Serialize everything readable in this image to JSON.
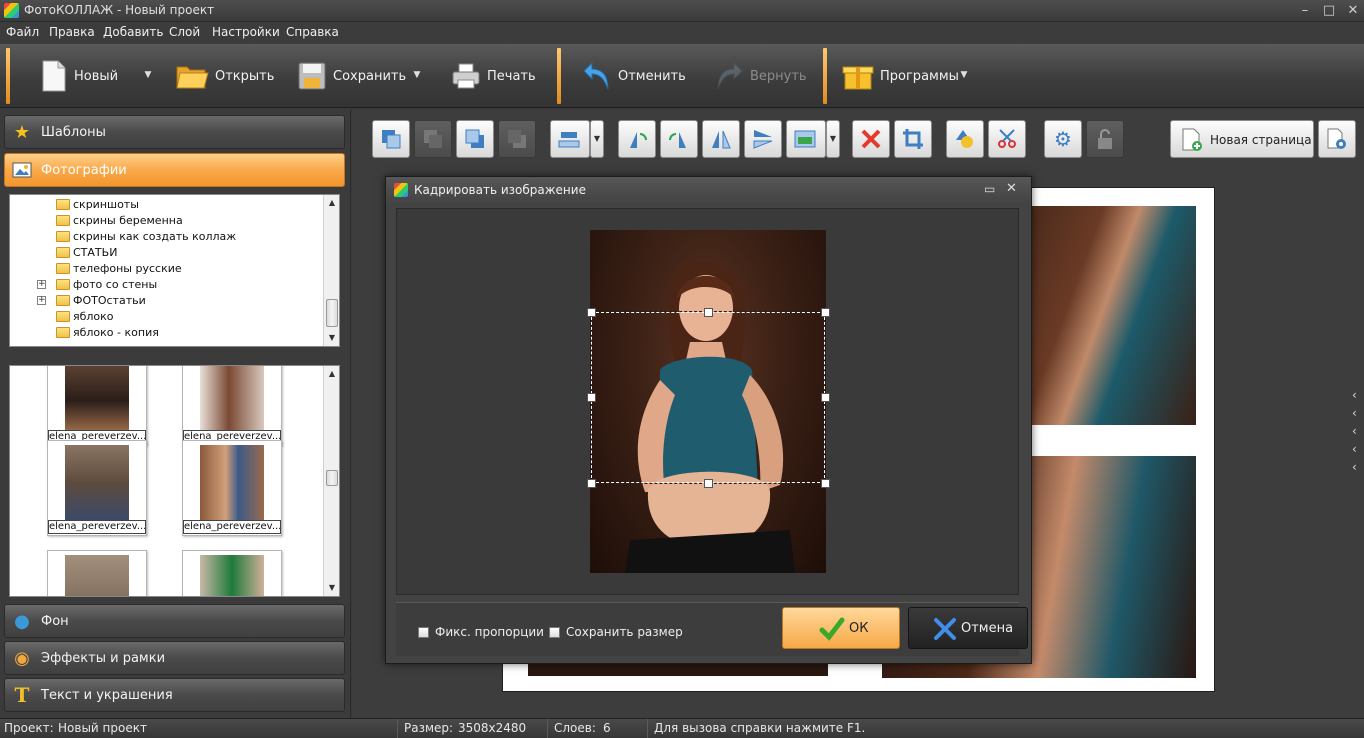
{
  "window": {
    "title": "ФотоКОЛЛАЖ - Новый проект",
    "minimize": "–",
    "maximize": "□",
    "close": "✕"
  },
  "menu": [
    "Файл",
    "Правка",
    "Добавить",
    "Слой",
    "Настройки",
    "Справка"
  ],
  "toolbar": {
    "new": "Новый",
    "open": "Открыть",
    "save": "Сохранить",
    "print": "Печать",
    "undo": "Отменить",
    "redo": "Вернуть",
    "programs": "Программы"
  },
  "left_panel": {
    "templates": "Шаблоны",
    "photos": "Фотографии",
    "background": "Фон",
    "effects": "Эффекты и рамки",
    "text": "Текст и украшения"
  },
  "folder_tree": [
    "скриншоты",
    "скрины беременна",
    "скрины как создать коллаж",
    "СТАТЬИ",
    "телефоны русские",
    "фото со стены",
    "ФОТОстатьи",
    "яблоко",
    "яблоко - копия"
  ],
  "gallery": {
    "caption": "elena_pereverzev..."
  },
  "edit_toolbar": {
    "new_page": "Новая страница"
  },
  "dialog": {
    "title": "Кадрировать изображение",
    "fix_proportions": "Фикс. пропорции",
    "keep_size": "Сохранить размер",
    "ok": "ОК",
    "cancel": "Отмена"
  },
  "status": {
    "project_label": "Проект:",
    "project_value": "Новый проект",
    "size_label": "Размер:",
    "size_value": "3508x2480",
    "layers_label": "Слоев:",
    "layers_value": "6",
    "hint": "Для вызова справки нажмите F1."
  },
  "colors": {
    "accent": "#f9a94a",
    "toolbar_separator": "#f0a03a",
    "panel_bg": "#3b3b3b"
  }
}
